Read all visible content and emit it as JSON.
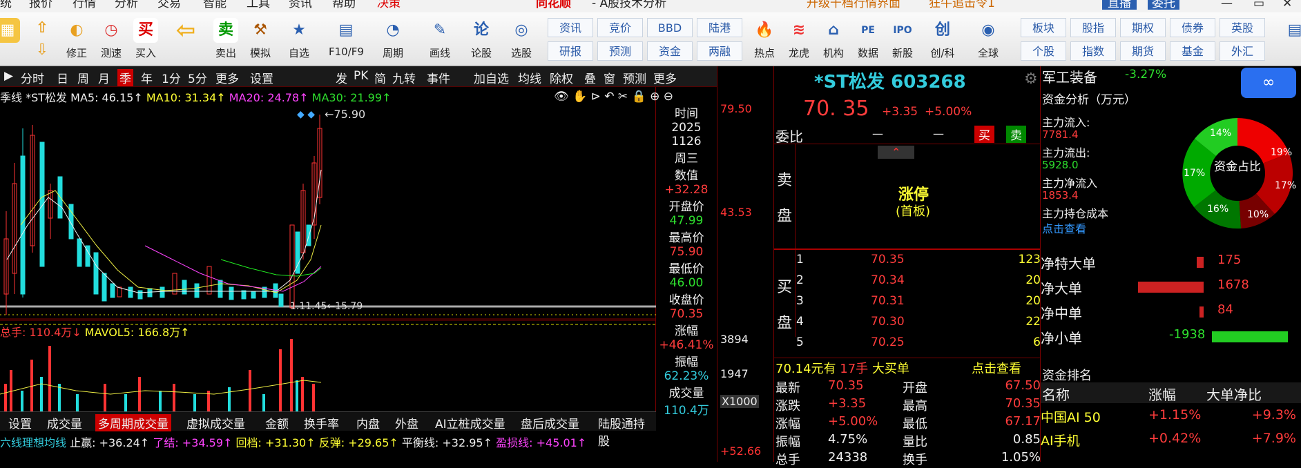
{
  "menu": {
    "items": [
      "统",
      "报价",
      "行情",
      "分析",
      "交易",
      "智能",
      "工具",
      "资讯",
      "帮助",
      "决策"
    ],
    "brand": "同花顺",
    "title": "- A股技术分析",
    "upgrade": "升级千档行情界面",
    "promo": "狂牛追击令1",
    "live": "直播",
    "entrust": "委托"
  },
  "toolbar": {
    "buttons": [
      "修正",
      "测速",
      "买入",
      "",
      "卖出",
      "模拟",
      "自选",
      "F10/F9",
      "周期",
      "画线",
      "论股",
      "选股",
      "",
      "",
      "",
      "",
      "热点",
      "龙虎",
      "机构",
      "数据",
      "新股",
      "创/科",
      "全球"
    ],
    "links1": [
      "资讯",
      "竞价",
      "BBD",
      "陆港"
    ],
    "links2": [
      "研报",
      "预测",
      "资金",
      "两融"
    ],
    "links3": [
      "板块",
      "股指",
      "期权",
      "债券",
      "英股"
    ],
    "links4": [
      "个股",
      "指数",
      "期货",
      "基金",
      "外汇"
    ]
  },
  "tabs": {
    "left": [
      "分时",
      "日",
      "周",
      "月",
      "季",
      "年",
      "1分",
      "5分",
      "更多",
      "设置"
    ],
    "right": [
      "发",
      "PK",
      "简",
      "九转",
      "事件",
      "加自选",
      "均线",
      "除权",
      "叠",
      "窗",
      "预测",
      "更多"
    ]
  },
  "chart": {
    "label": "季线",
    "name": "*ST松发",
    "ma5": "MA5: 46.15↑",
    "ma10": "MA10: 31.34↑",
    "ma20": "MA20: 24.78↑",
    "ma30": "MA30: 21.99↑",
    "high": "75.90",
    "low": "1.45",
    "low2": "15.79"
  },
  "chart_data": {
    "type": "candlestick",
    "y_axis": [
      "79.50",
      "43.53",
      "3894",
      "1947",
      "X1000",
      "+52.66"
    ]
  },
  "volume": {
    "label": "总手: 110.4万↓",
    "mavol": "MAVOL5: 166.8万↑"
  },
  "bottomtabs": [
    "设置",
    "成交量",
    "多周期成交量",
    "虚拟成交量",
    "金额",
    "换手率",
    "内盘",
    "外盘",
    "AI立桩成交量",
    "盘后成交量",
    "陆股通持股"
  ],
  "indicator": {
    "name": "六线理想均线",
    "a": "止赢: +36.24↑",
    "b": "了结: +34.59↑",
    "c": "回档: +31.30↑",
    "d": "反弹: +29.65↑",
    "e": "平衡线: +32.95↑",
    "f": "盈损线: +45.01↑"
  },
  "info": {
    "time_label": "时间",
    "year": "2025",
    "date": "1126",
    "weekday": "周三",
    "value_label": "数值",
    "value": "+32.28",
    "open_label": "开盘价",
    "open": "47.99",
    "high_label": "最高价",
    "high": "75.90",
    "low_label": "最低价",
    "low": "46.00",
    "close_label": "收盘价",
    "close": "70.35",
    "chg_label": "涨幅",
    "chg": "+46.41%",
    "amp_label": "振幅",
    "amp": "62.23%",
    "vol_label": "成交量",
    "vol": "110.4万"
  },
  "quote": {
    "name": "*ST松发 603268",
    "price": "70. 35",
    "change": "+3.35",
    "pct": "+5.00%",
    "weibi": "委比",
    "dash1": "—",
    "dash2": "—",
    "buy": "买",
    "sell": "卖",
    "sell_side": "卖盘",
    "buy_side": "买盘",
    "limit": "涨停",
    "limit_sub": "(首板)",
    "bids": [
      [
        "1",
        "70.35",
        "123"
      ],
      [
        "2",
        "70.34",
        "20"
      ],
      [
        "3",
        "70.31",
        "20"
      ],
      [
        "4",
        "70.30",
        "22"
      ],
      [
        "5",
        "70.25",
        "6"
      ]
    ],
    "big": "70.14元有",
    "big_qty": "17手",
    "big_label": "大买单",
    "big_link": "点击查看",
    "stats": [
      [
        "最新",
        "70.35",
        "开盘",
        "67.50"
      ],
      [
        "涨跌",
        "+3.35",
        "最高",
        "70.35"
      ],
      [
        "涨幅",
        "+5.00%",
        "最低",
        "67.17"
      ],
      [
        "振幅",
        "4.75%",
        "量比",
        "0.85"
      ],
      [
        "总手",
        "24338",
        "换手",
        "1.05%"
      ]
    ]
  },
  "right": {
    "sector": "军工装备",
    "sector_pct": "-3.27%",
    "fund_title": "资金分析（万元）",
    "in_label": "主力流入:",
    "in": "7781.4",
    "out_label": "主力流出:",
    "out": "5928.0",
    "net_label": "主力净流入",
    "net": "1853.4",
    "cost_label": "主力持仓成本",
    "cost_link": "点击查看",
    "donut_center": "资金占比",
    "slices": [
      "19%",
      "17%",
      "10%",
      "16%",
      "17%",
      "14%"
    ],
    "flows": [
      [
        "净特大单",
        "175"
      ],
      [
        "净大单",
        "1678"
      ],
      [
        "净中单",
        "84"
      ],
      [
        "净小单",
        "-1938"
      ]
    ],
    "rank_title": "资金排名",
    "rank_h": [
      "名称",
      "涨幅",
      "大单净比"
    ],
    "rank": [
      [
        "中国AI 50",
        "+1.15%",
        "+9.3%"
      ],
      [
        "AI手机",
        "+0.42%",
        "+7.9%"
      ]
    ]
  }
}
